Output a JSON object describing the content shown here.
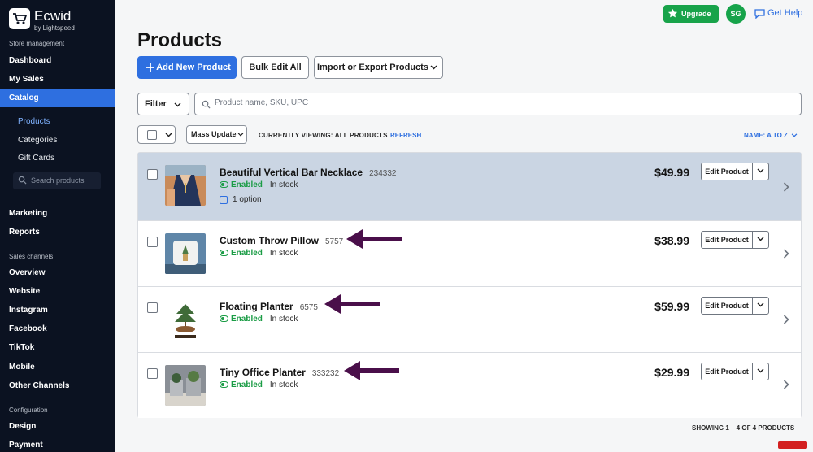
{
  "app": {
    "brand": "Ecwid",
    "brand_sub": "by Lightspeed"
  },
  "sidebar": {
    "section_store": "Store management",
    "items_top": [
      {
        "label": "Dashboard"
      },
      {
        "label": "My Sales"
      },
      {
        "label": "Catalog",
        "active": true
      }
    ],
    "catalog_sub": [
      {
        "label": "Products",
        "current": true
      },
      {
        "label": "Categories"
      },
      {
        "label": "Gift Cards"
      }
    ],
    "search_placeholder": "Search products",
    "items_mid": [
      {
        "label": "Marketing"
      },
      {
        "label": "Reports"
      }
    ],
    "section_channels": "Sales channels",
    "channels": [
      {
        "label": "Overview"
      },
      {
        "label": "Website"
      },
      {
        "label": "Instagram"
      },
      {
        "label": "Facebook"
      },
      {
        "label": "TikTok"
      },
      {
        "label": "Mobile"
      },
      {
        "label": "Other Channels"
      }
    ],
    "section_config": "Configuration",
    "config": [
      {
        "label": "Design"
      },
      {
        "label": "Payment"
      }
    ]
  },
  "topbar": {
    "upgrade_label": "Upgrade",
    "avatar_initials": "SG",
    "help_label": "Get Help"
  },
  "page": {
    "title": "Products"
  },
  "toolbar": {
    "add_label": "Add New Product",
    "bulk_label": "Bulk Edit All",
    "import_label": "Import or Export Products",
    "filter_label": "Filter",
    "search_placeholder": "Product name, SKU, UPC",
    "mass_update_label": "Mass Update",
    "viewing_label": "CURRENTLY VIEWING: ALL PRODUCTS",
    "refresh_label": "REFRESH",
    "sort_label": "NAME: A TO Z"
  },
  "products": [
    {
      "name": "Beautiful Vertical Bar Necklace",
      "sku": "234332",
      "status": "Enabled",
      "stock": "In stock",
      "options": "1 option",
      "price": "$49.99",
      "edit_label": "Edit Product"
    },
    {
      "name": "Custom Throw Pillow",
      "sku": "5757",
      "status": "Enabled",
      "stock": "In stock",
      "price": "$38.99",
      "edit_label": "Edit Product"
    },
    {
      "name": "Floating Planter",
      "sku": "6575",
      "status": "Enabled",
      "stock": "In stock",
      "price": "$59.99",
      "edit_label": "Edit Product"
    },
    {
      "name": "Tiny Office Planter",
      "sku": "333232",
      "status": "Enabled",
      "stock": "In stock",
      "price": "$29.99",
      "edit_label": "Edit Product"
    }
  ],
  "footer": {
    "showing_label": "SHOWING 1 – 4 OF 4 PRODUCTS"
  },
  "colors": {
    "sidebar_bg": "#0b1221",
    "accent": "#2e6fe0",
    "enabled_green": "#1a9c45",
    "upgrade_green": "#18a34a",
    "annotation_arrow": "#4a0f4a",
    "highlight_row": "#cad5e3"
  }
}
